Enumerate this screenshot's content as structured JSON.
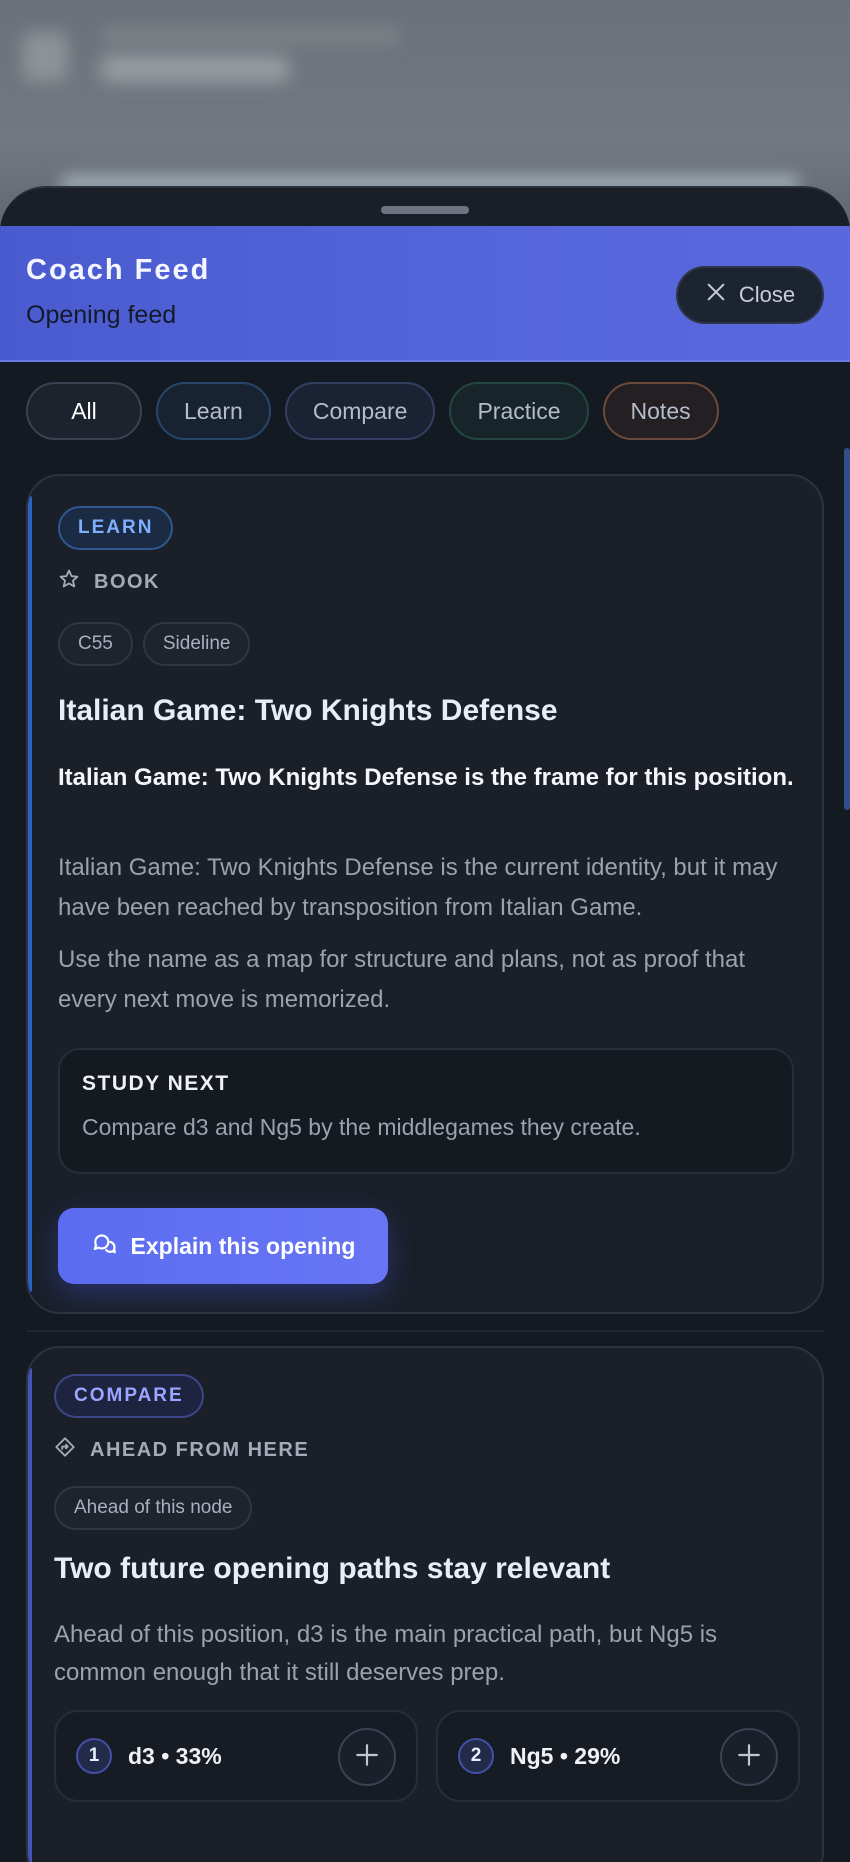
{
  "header": {
    "title": "Coach Feed",
    "subtitle": "Opening feed",
    "close_label": "Close"
  },
  "filters": [
    {
      "label": "All"
    },
    {
      "label": "Learn"
    },
    {
      "label": "Compare"
    },
    {
      "label": "Practice"
    },
    {
      "label": "Notes"
    }
  ],
  "cards": [
    {
      "tag": "LEARN",
      "meta": "BOOK",
      "chips": [
        "C55",
        "Sideline"
      ],
      "title": "Italian Game: Two Knights Defense",
      "lead": "Italian Game: Two Knights Defense is the frame for this position.",
      "paragraphs": [
        "Italian Game: Two Knights Defense is the current identity, but it may have been reached by transposition from Italian Game.",
        "Use the name as a map for structure and plans, not as proof that every next move is memorized."
      ],
      "study": {
        "title": "STUDY NEXT",
        "text": "Compare d3 and Ng5 by the middlegames they create."
      },
      "button_label": "Explain this opening"
    },
    {
      "tag": "COMPARE",
      "meta": "AHEAD FROM HERE",
      "chips": [
        "Ahead of this node"
      ],
      "title": "Two future opening paths stay relevant",
      "paragraphs": [
        "Ahead of this position, d3 is the main practical path, but Ng5 is common enough that it still deserves prep."
      ],
      "moves": [
        {
          "num": "1",
          "text": "d3 • 33%"
        },
        {
          "num": "2",
          "text": "Ng5 • 29%"
        }
      ]
    }
  ],
  "icons": {
    "close": "close-icon",
    "book": "star-icon",
    "ahead": "route-icon",
    "explain": "chat-bubbles-icon",
    "add": "plus-icon"
  },
  "colors": {
    "header_accent": "#5262d8",
    "learn_accent": "#2b63c4",
    "compare_accent": "#4654b8",
    "primary_button": "#5b6cf0"
  }
}
